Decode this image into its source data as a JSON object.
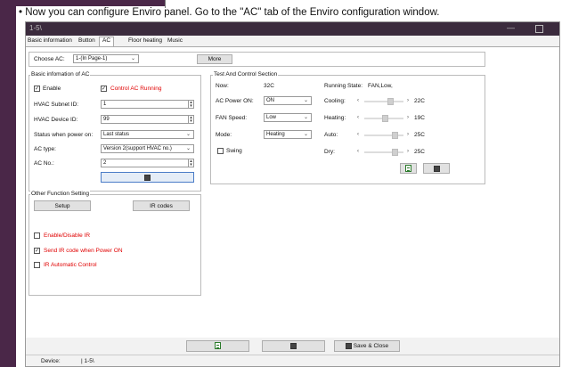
{
  "instruction": "• Now you can configure Enviro panel. Go to the \"AC\" tab of the Enviro configuration window.",
  "window": {
    "title": "1-5\\",
    "minimize_label": "—"
  },
  "tabs": [
    "Basic information",
    "Button",
    "AC",
    "Floor heating",
    "Music"
  ],
  "choose_ac": {
    "label": "Choose AC:",
    "value": "1-(In Page-1)",
    "more_label": "More"
  },
  "basic_info": {
    "title": "Basic infomation of AC",
    "enable_label": "Enable",
    "control_running_label": "Control AC Running",
    "subnet_label": "HVAC Subnet ID:",
    "subnet_value": "1",
    "device_label": "HVAC Device ID:",
    "device_value": "99",
    "power_on_label": "Status when power on:",
    "power_on_value": "Last status",
    "ac_type_label": "AC type:",
    "ac_type_value": "Version 2(support HVAC no.)",
    "ac_no_label": "AC No.:",
    "ac_no_value": "2"
  },
  "test_control": {
    "title": "Test And Control Section",
    "now_label": "Now:",
    "now_value": "32C",
    "running_label": "Running State:",
    "running_value": "FAN,Low,",
    "power_label": "AC Power ON:",
    "power_value": "ON",
    "fan_label": "FAN Speed:",
    "fan_value": "Low",
    "mode_label": "Mode:",
    "mode_value": "Heating",
    "swing_label": "Swing",
    "cooling_label": "Cooling:",
    "cooling_value": "22C",
    "cooling_pos": 0.7,
    "heating_label": "Heating:",
    "heating_value": "19C",
    "heating_pos": 0.55,
    "auto_label": "Auto:",
    "auto_value": "25C",
    "auto_pos": 0.85,
    "dry_label": "Dry:",
    "dry_value": "25C",
    "dry_pos": 0.85
  },
  "other": {
    "title": "Other Function Setting",
    "setup_label": "Setup",
    "ir_codes_label": "IR codes",
    "enable_ir_label": "Enable/Disable IR",
    "send_ir_label": "Send IR code when Power ON",
    "ir_auto_label": "IR Automatic Control"
  },
  "footer": {
    "save_close_label": "Save & Close"
  },
  "status": {
    "device_label": "Device:",
    "device_value": "| 1-5\\"
  }
}
